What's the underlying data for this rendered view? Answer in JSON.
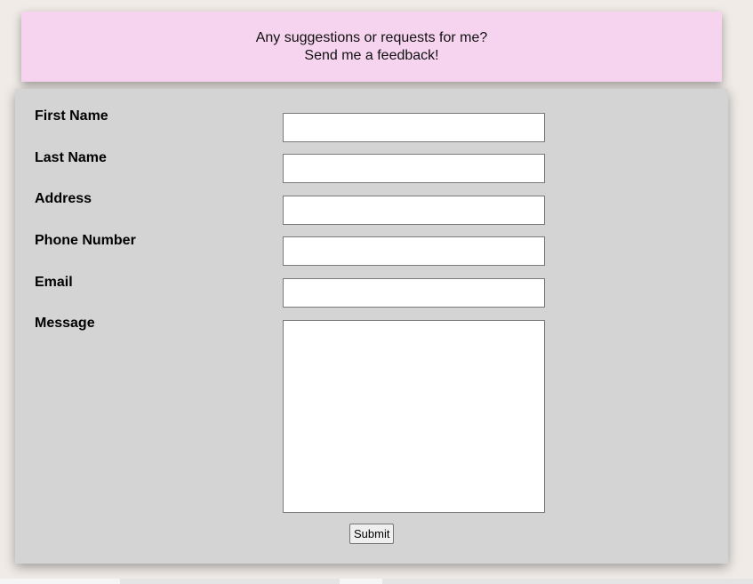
{
  "banner": {
    "line1": "Any suggestions or requests for me?",
    "line2": "Send me a feedback!"
  },
  "form": {
    "fields": [
      {
        "label": "First Name",
        "value": "",
        "placeholder": ""
      },
      {
        "label": "Last Name",
        "value": "",
        "placeholder": ""
      },
      {
        "label": "Address",
        "value": "",
        "placeholder": ""
      },
      {
        "label": "Phone Number",
        "value": "",
        "placeholder": ""
      },
      {
        "label": "Email",
        "value": "",
        "placeholder": ""
      }
    ],
    "message": {
      "label": "Message",
      "value": "",
      "placeholder": ""
    },
    "submit_label": "Submit"
  },
  "colors": {
    "banner_bg": "#f6d3ee",
    "form_bg": "#d4d4d4",
    "page_bg": "#f0ebe7"
  }
}
